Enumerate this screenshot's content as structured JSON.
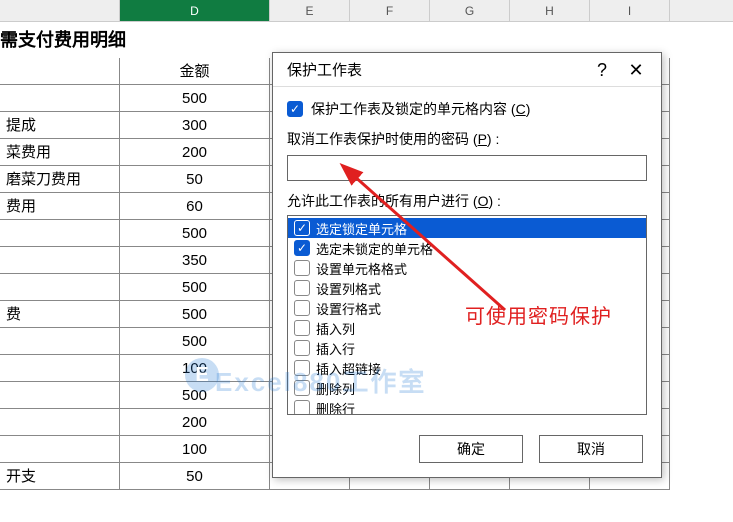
{
  "columns": {
    "c": "",
    "d": "D",
    "e": "E",
    "f": "F",
    "g": "G",
    "h": "H",
    "i": "I"
  },
  "sheet_title": "需支付费用明细",
  "header": {
    "c": "",
    "d": "金额"
  },
  "rows": [
    {
      "label": "",
      "amount": "500"
    },
    {
      "label": "提成",
      "amount": "300"
    },
    {
      "label": "菜费用",
      "amount": "200"
    },
    {
      "label": "磨菜刀费用",
      "amount": "50"
    },
    {
      "label": "费用",
      "amount": "60"
    },
    {
      "label": "",
      "amount": "500"
    },
    {
      "label": "",
      "amount": "350"
    },
    {
      "label": "",
      "amount": "500"
    },
    {
      "label": "费",
      "amount": "500"
    },
    {
      "label": "",
      "amount": "500"
    },
    {
      "label": "",
      "amount": "100"
    },
    {
      "label": "",
      "amount": "500"
    },
    {
      "label": "",
      "amount": "200"
    },
    {
      "label": "",
      "amount": "100"
    },
    {
      "label": "开支",
      "amount": "50"
    }
  ],
  "dialog": {
    "title": "保护工作表",
    "help": "?",
    "close": "✕",
    "protect_label_a": "保护工作表及锁定的单元格内容 (",
    "protect_label_b": "C",
    "protect_label_c": ")",
    "pw_label_a": "取消工作表保护时使用的密码 (",
    "pw_label_b": "P",
    "pw_label_c": ") :",
    "perm_label_a": "允许此工作表的所有用户进行 (",
    "perm_label_b": "O",
    "perm_label_c": ") :",
    "perms": [
      {
        "label": "选定锁定单元格",
        "checked": true,
        "selected": true
      },
      {
        "label": "选定未锁定的单元格",
        "checked": true,
        "selected": false
      },
      {
        "label": "设置单元格格式",
        "checked": false,
        "selected": false
      },
      {
        "label": "设置列格式",
        "checked": false,
        "selected": false
      },
      {
        "label": "设置行格式",
        "checked": false,
        "selected": false
      },
      {
        "label": "插入列",
        "checked": false,
        "selected": false
      },
      {
        "label": "插入行",
        "checked": false,
        "selected": false
      },
      {
        "label": "插入超链接",
        "checked": false,
        "selected": false
      },
      {
        "label": "删除列",
        "checked": false,
        "selected": false
      },
      {
        "label": "删除行",
        "checked": false,
        "selected": false
      }
    ],
    "ok": "确定",
    "cancel": "取消"
  },
  "annotation": "可使用密码保护",
  "watermark": "Excel880工作室"
}
